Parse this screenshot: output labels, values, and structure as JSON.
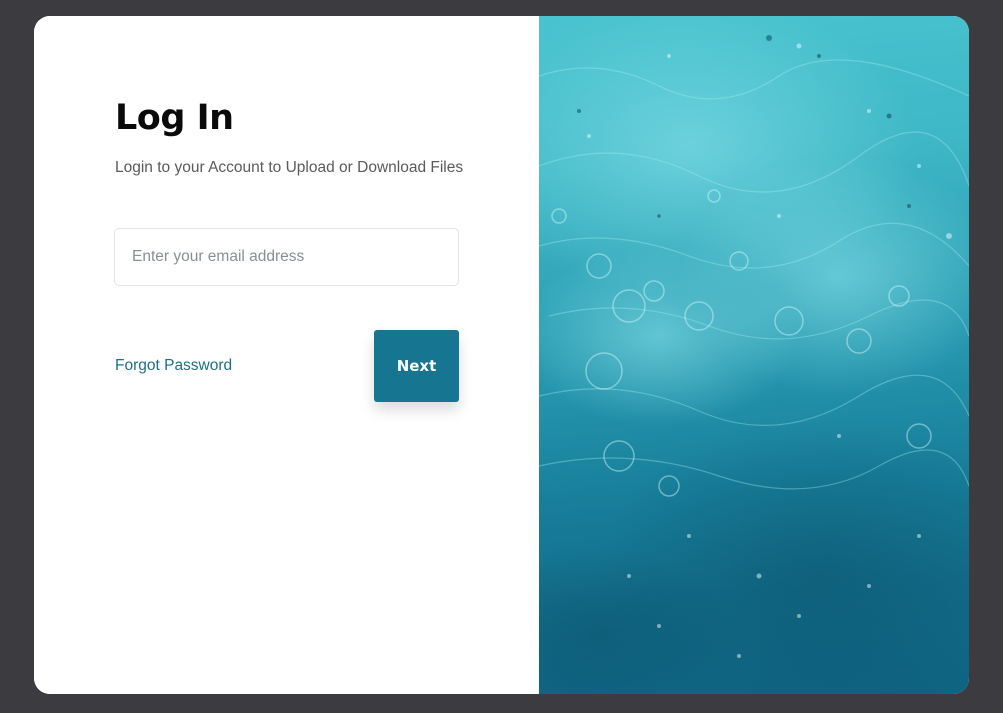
{
  "login": {
    "title": "Log In",
    "subtitle": "Login to your Account to Upload or Download Files",
    "email_placeholder": "Enter your email address",
    "email_value": "",
    "forgot_label": "Forgot Password",
    "next_label": "Next"
  },
  "colors": {
    "page_background": "#3b3b40",
    "card_background": "#ffffff",
    "accent": "#167590",
    "link": "#1c6f85",
    "water_light": "#48c3cf",
    "water_dark": "#0f6482"
  },
  "image": {
    "subject": "water-surface-photo"
  }
}
